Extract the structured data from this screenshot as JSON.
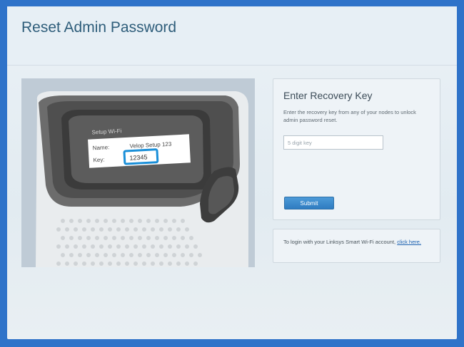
{
  "header": {
    "title": "Reset Admin Password"
  },
  "illustration": {
    "screen_title": "Setup Wi-Fi",
    "name_label": "Name:",
    "name_value": "Velop Setup 123",
    "key_label": "Key:",
    "key_value": "12345",
    "highlight_color": "#1a8fd8"
  },
  "recovery": {
    "title": "Enter Recovery Key",
    "description": "Enter the recovery key from any of your nodes to unlock admin password reset.",
    "input_placeholder": "5 digit key",
    "input_value": "",
    "submit_label": "Submit"
  },
  "login": {
    "text": "To login with your Linksys Smart Wi-Fi account,",
    "link_text": "click here."
  },
  "colors": {
    "border": "#2f73c9",
    "title": "#2e5d7a",
    "button": "#2f7cc1",
    "link": "#1d62b0"
  }
}
